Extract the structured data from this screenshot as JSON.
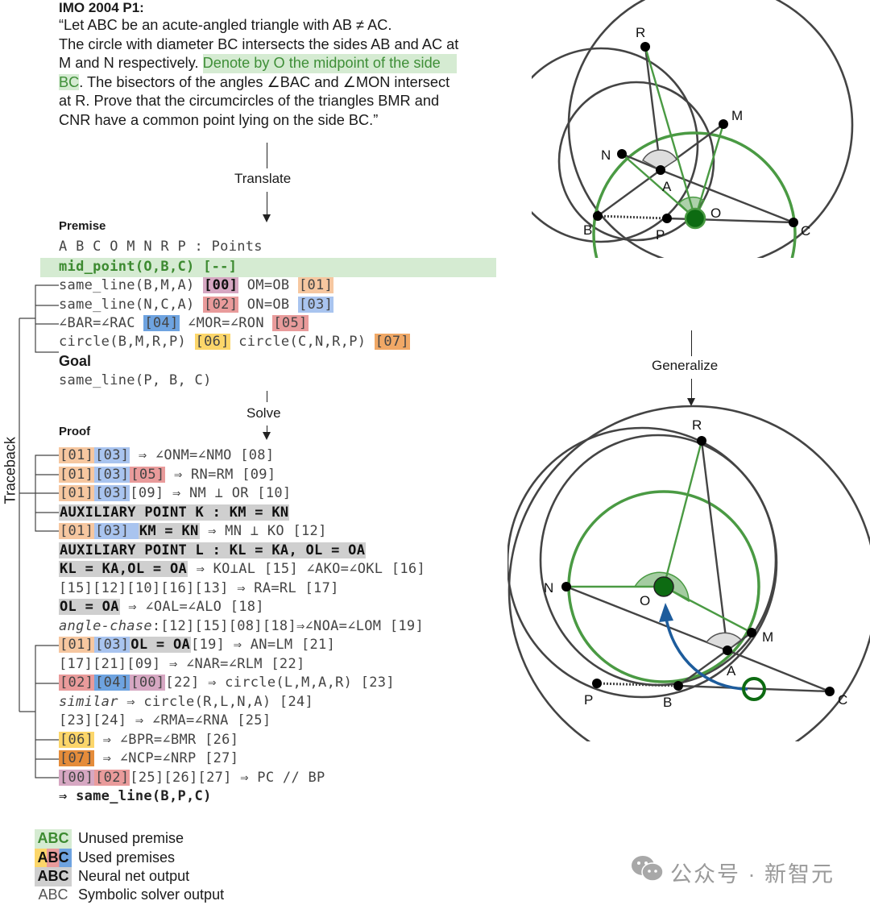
{
  "problem": {
    "title": "IMO 2004 P1:",
    "line1": "“Let ABC be an acute-angled triangle with AB ≠ AC.",
    "line2": "The circle with diameter BC intersects the sides AB and AC at",
    "line3_plain": "M and N respectively. ",
    "line3_highlight": "Denote by O the midpoint of the side",
    "line4_highlight": "BC",
    "line4_plain": ". The bisectors of the angles ∠BAC and ∠MON intersect",
    "line5": "at R. Prove that the circumcircles of the triangles BMR and",
    "line6": "CNR have a common point lying on the side BC.”"
  },
  "arrows": {
    "translate": "Translate",
    "solve": "Solve",
    "generalize": "Generalize"
  },
  "premise": {
    "heading": "Premise",
    "points_line": "A B C O M N R P : Points",
    "unused": "mid_point(O,B,C) [--]",
    "rows": [
      {
        "a": "same_line(B,M,A) ",
        "a_tag": "[00]",
        "b": " OM=OB ",
        "b_tag": "[01]"
      },
      {
        "a": "same_line(N,C,A) ",
        "a_tag": "[02]",
        "b": " ON=OB ",
        "b_tag": "[03]"
      },
      {
        "a": "∠BAR=∠RAC ",
        "a_tag": "[04]",
        "b": " ∠MOR=∠RON ",
        "b_tag": "[05]"
      },
      {
        "a": "circle(B,M,R,P) ",
        "a_tag": "[06]",
        "b": " circle(C,N,R,P) ",
        "b_tag": "[07]"
      }
    ]
  },
  "goal": {
    "heading": "Goal",
    "statement": "same_line(P, B, C)"
  },
  "proof": {
    "heading": "Proof",
    "lines": {
      "l1": {
        "t1": "[01]",
        "t2": "[03]",
        "rest": " ⇒ ∠ONM=∠NMO [08]"
      },
      "l2": {
        "t1": "[01]",
        "t2": "[03]",
        "t3": "[05]",
        "rest": " ⇒ RN=RM [09]"
      },
      "l3": {
        "t1": "[01]",
        "t2": "[03]",
        "rest": "[09] ⇒ NM ⊥ OR [10]"
      },
      "l4": {
        "neural": "AUXILIARY POINT K : KM = KN"
      },
      "l5": {
        "t1": "[01]",
        "t2": "[03] ",
        "neural": "KM = KN",
        "rest": " ⇒ MN ⊥ KO [12]"
      },
      "l6": {
        "neural": "AUXILIARY POINT L : KL = KA, OL = OA"
      },
      "l7": {
        "neural": "KL = KA,OL = OA",
        "rest": " ⇒ KO⊥AL [15] ∠AKO=∠OKL [16]"
      },
      "l8": {
        "rest": "[15][12][10][16][13] ⇒ RA=RL [17]"
      },
      "l9": {
        "neural": "OL = OA",
        "rest": " ⇒ ∠OAL=∠ALO [18]"
      },
      "l10": {
        "italic": "angle-chase",
        "rest": ":[12][15][08][18]⇒∠NOA=∠LOM [19]"
      },
      "l11": {
        "t1": "[01]",
        "t2": "[03]",
        "neural": "OL = OA",
        "rest": "[19] ⇒ AN=LM [21]"
      },
      "l12": {
        "rest": "[17][21][09] ⇒ ∠NAR=∠RLM [22]"
      },
      "l13": {
        "t1": "[02]",
        "t2": "[04]",
        "t3": "[00]",
        "rest": "[22] ⇒ circle(L,M,A,R) [23]"
      },
      "l14": {
        "italic": "similar",
        "rest": " ⇒ circle(R,L,N,A) [24]"
      },
      "l15": {
        "rest": "[23][24] ⇒ ∠RMA=∠RNA [25]"
      },
      "l16": {
        "t1": "[06]",
        "rest": " ⇒ ∠BPR=∠BMR [26]"
      },
      "l17": {
        "t1": "[07]",
        "rest": " ⇒ ∠NCP=∠NRP [27]"
      },
      "l18": {
        "t1": "[00]",
        "t2": "[02]",
        "rest": "[25][26][27] ⇒ PC // BP"
      },
      "l19": {
        "rest": "⇒ same_line(B,P,C)"
      }
    }
  },
  "traceback_label": "Traceback",
  "legend": [
    {
      "swatch": "ABC",
      "label": "Unused premise"
    },
    {
      "swatch": "ABC",
      "label": "Used premises"
    },
    {
      "swatch": "ABC",
      "label": "Neural net output"
    },
    {
      "swatch": "ABC",
      "label": "Symbolic solver output"
    }
  ],
  "diagram_top": {
    "labels": {
      "R": "R",
      "M": "M",
      "N": "N",
      "A": "A",
      "O": "O",
      "B": "B",
      "P": "P",
      "C": "C"
    }
  },
  "diagram_bottom": {
    "labels": {
      "R": "R",
      "N": "N",
      "O": "O",
      "M": "M",
      "A": "A",
      "P": "P",
      "B": "B",
      "C": "C"
    }
  },
  "colors": {
    "unused_green": "#3c8a30",
    "unused_bg": "#d5ebd2",
    "neural_gray": "#cfcfcf",
    "diagram_green": "#4a9a43",
    "diagram_dark_green": "#0d6b12",
    "arrow_blue": "#1d5c9c"
  },
  "watermark": {
    "icon": "wechat-icon",
    "text": "公众号 · 新智元"
  }
}
